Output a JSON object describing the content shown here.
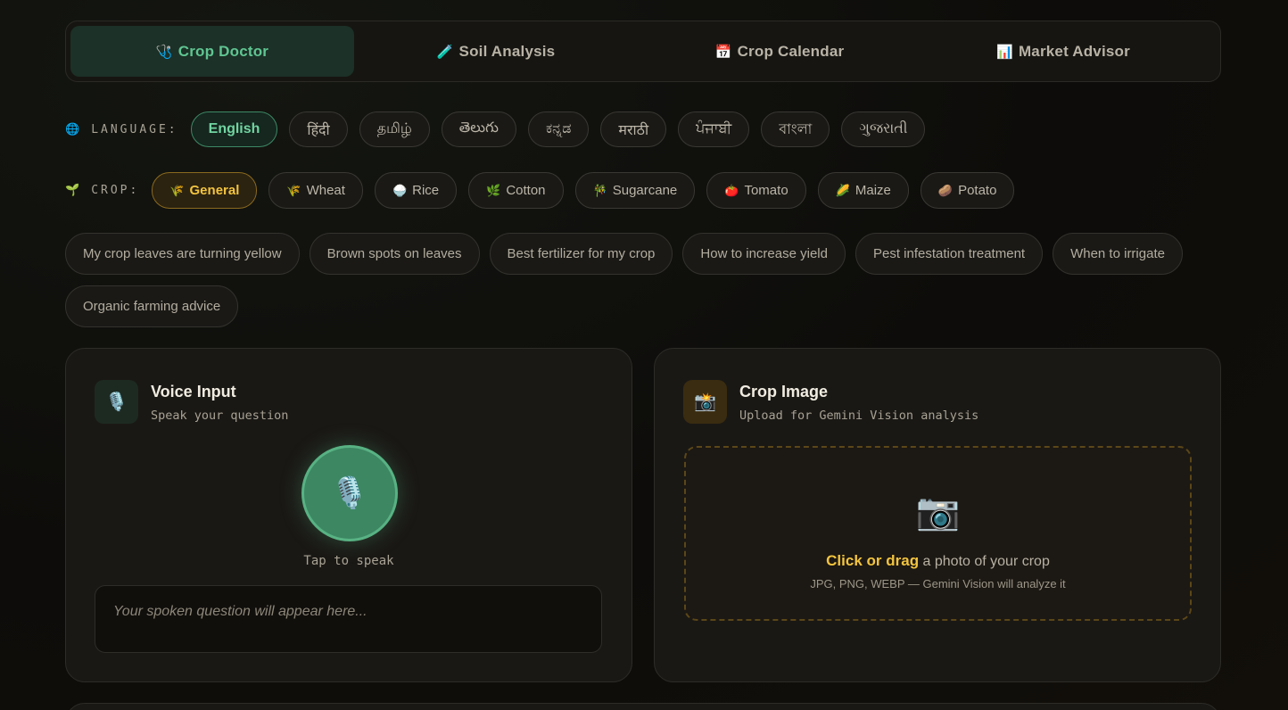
{
  "tabs": [
    {
      "label": "Crop Doctor",
      "icon": "🩺",
      "active": true
    },
    {
      "label": "Soil Analysis",
      "icon": "🧪"
    },
    {
      "label": "Crop Calendar",
      "icon": "📅"
    },
    {
      "label": "Market Advisor",
      "icon": "📊"
    }
  ],
  "language": {
    "label": "LANGUAGE:",
    "icon": "🌐",
    "options": [
      "English",
      "हिंदी",
      "தமிழ்",
      "తెలుగు",
      "ಕನ್ನಡ",
      "मराठी",
      "ਪੰਜਾਬੀ",
      "বাংলা",
      "ગુજરાતી"
    ],
    "selected": "English"
  },
  "crop": {
    "label": "CROP:",
    "icon": "🌱",
    "options": [
      {
        "label": "General",
        "icon": "🌾"
      },
      {
        "label": "Wheat",
        "icon": "🌾"
      },
      {
        "label": "Rice",
        "icon": "🍚"
      },
      {
        "label": "Cotton",
        "icon": "🌿"
      },
      {
        "label": "Sugarcane",
        "icon": "🎋"
      },
      {
        "label": "Tomato",
        "icon": "🍅"
      },
      {
        "label": "Maize",
        "icon": "🌽"
      },
      {
        "label": "Potato",
        "icon": "🥔"
      }
    ],
    "selected": "General"
  },
  "suggestions": [
    "My crop leaves are turning yellow",
    "Brown spots on leaves",
    "Best fertilizer for my crop",
    "How to increase yield",
    "Pest infestation treatment",
    "When to irrigate",
    "Organic farming advice"
  ],
  "voice": {
    "title": "Voice Input",
    "subtitle": "Speak your question",
    "icon": "🎙️",
    "button_label": "Tap to speak",
    "placeholder": "Your spoken question will appear here..."
  },
  "image": {
    "title": "Crop Image",
    "subtitle": "Upload for Gemini Vision analysis",
    "icon": "📸",
    "drop_icon": "📷",
    "drop_strong": "Click or drag",
    "drop_rest": " a photo of your crop",
    "drop_hint": "JPG, PNG, WEBP — Gemini Vision will analyze it"
  }
}
